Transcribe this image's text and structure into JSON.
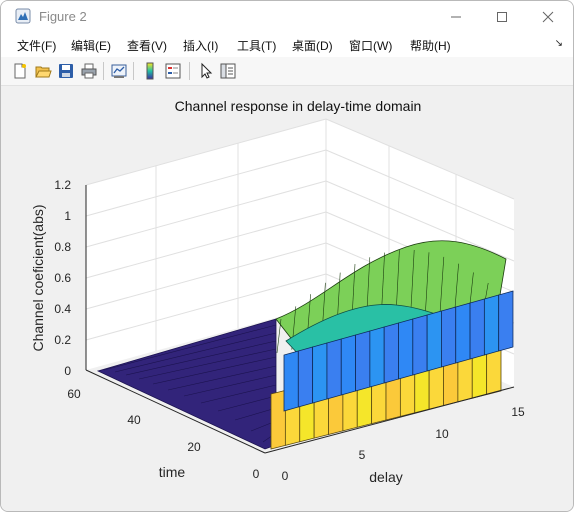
{
  "window": {
    "title": "Figure 2",
    "icons": [
      "matlab-figure-icon",
      "minimize-icon",
      "maximize-icon",
      "close-icon"
    ]
  },
  "menubar": {
    "items": [
      "文件(F)",
      "编辑(E)",
      "查看(V)",
      "插入(I)",
      "工具(T)",
      "桌面(D)",
      "窗口(W)",
      "帮助(H)"
    ],
    "overflow_glyph": "↘"
  },
  "toolbar": {
    "icons": [
      "new-figure-icon",
      "open-file-icon",
      "save-icon",
      "print-icon",
      "link-plot-icon",
      "colorbar-icon",
      "legend-icon",
      "pointer-icon",
      "property-inspector-icon"
    ]
  },
  "chart_data": {
    "type": "surface",
    "title": "Channel response in delay-time domain",
    "xlabel": "delay",
    "ylabel": "time",
    "zlabel": "Channel coeficient(abs)",
    "x_ticks": [
      "0",
      "5",
      "10",
      "15"
    ],
    "y_ticks": [
      "0",
      "20",
      "40",
      "60"
    ],
    "z_ticks": [
      "0",
      "0.2",
      "0.4",
      "0.6",
      "0.8",
      "1",
      "1.2"
    ],
    "xlim": [
      0,
      15
    ],
    "ylim": [
      0,
      64
    ],
    "zlim": [
      0,
      1.2
    ],
    "grid": true,
    "colormap": "parula",
    "series": [
      {
        "delay": 0,
        "time_range": [
          0,
          64
        ],
        "level": 0
      },
      {
        "delay": 6,
        "time_range": [
          0,
          64
        ],
        "level": 0.3
      },
      {
        "delay": 6,
        "time_range": [
          0,
          64
        ],
        "level": 0.6
      },
      {
        "delay": 6,
        "time_range": [
          0,
          64
        ],
        "level": 0.9
      }
    ]
  }
}
